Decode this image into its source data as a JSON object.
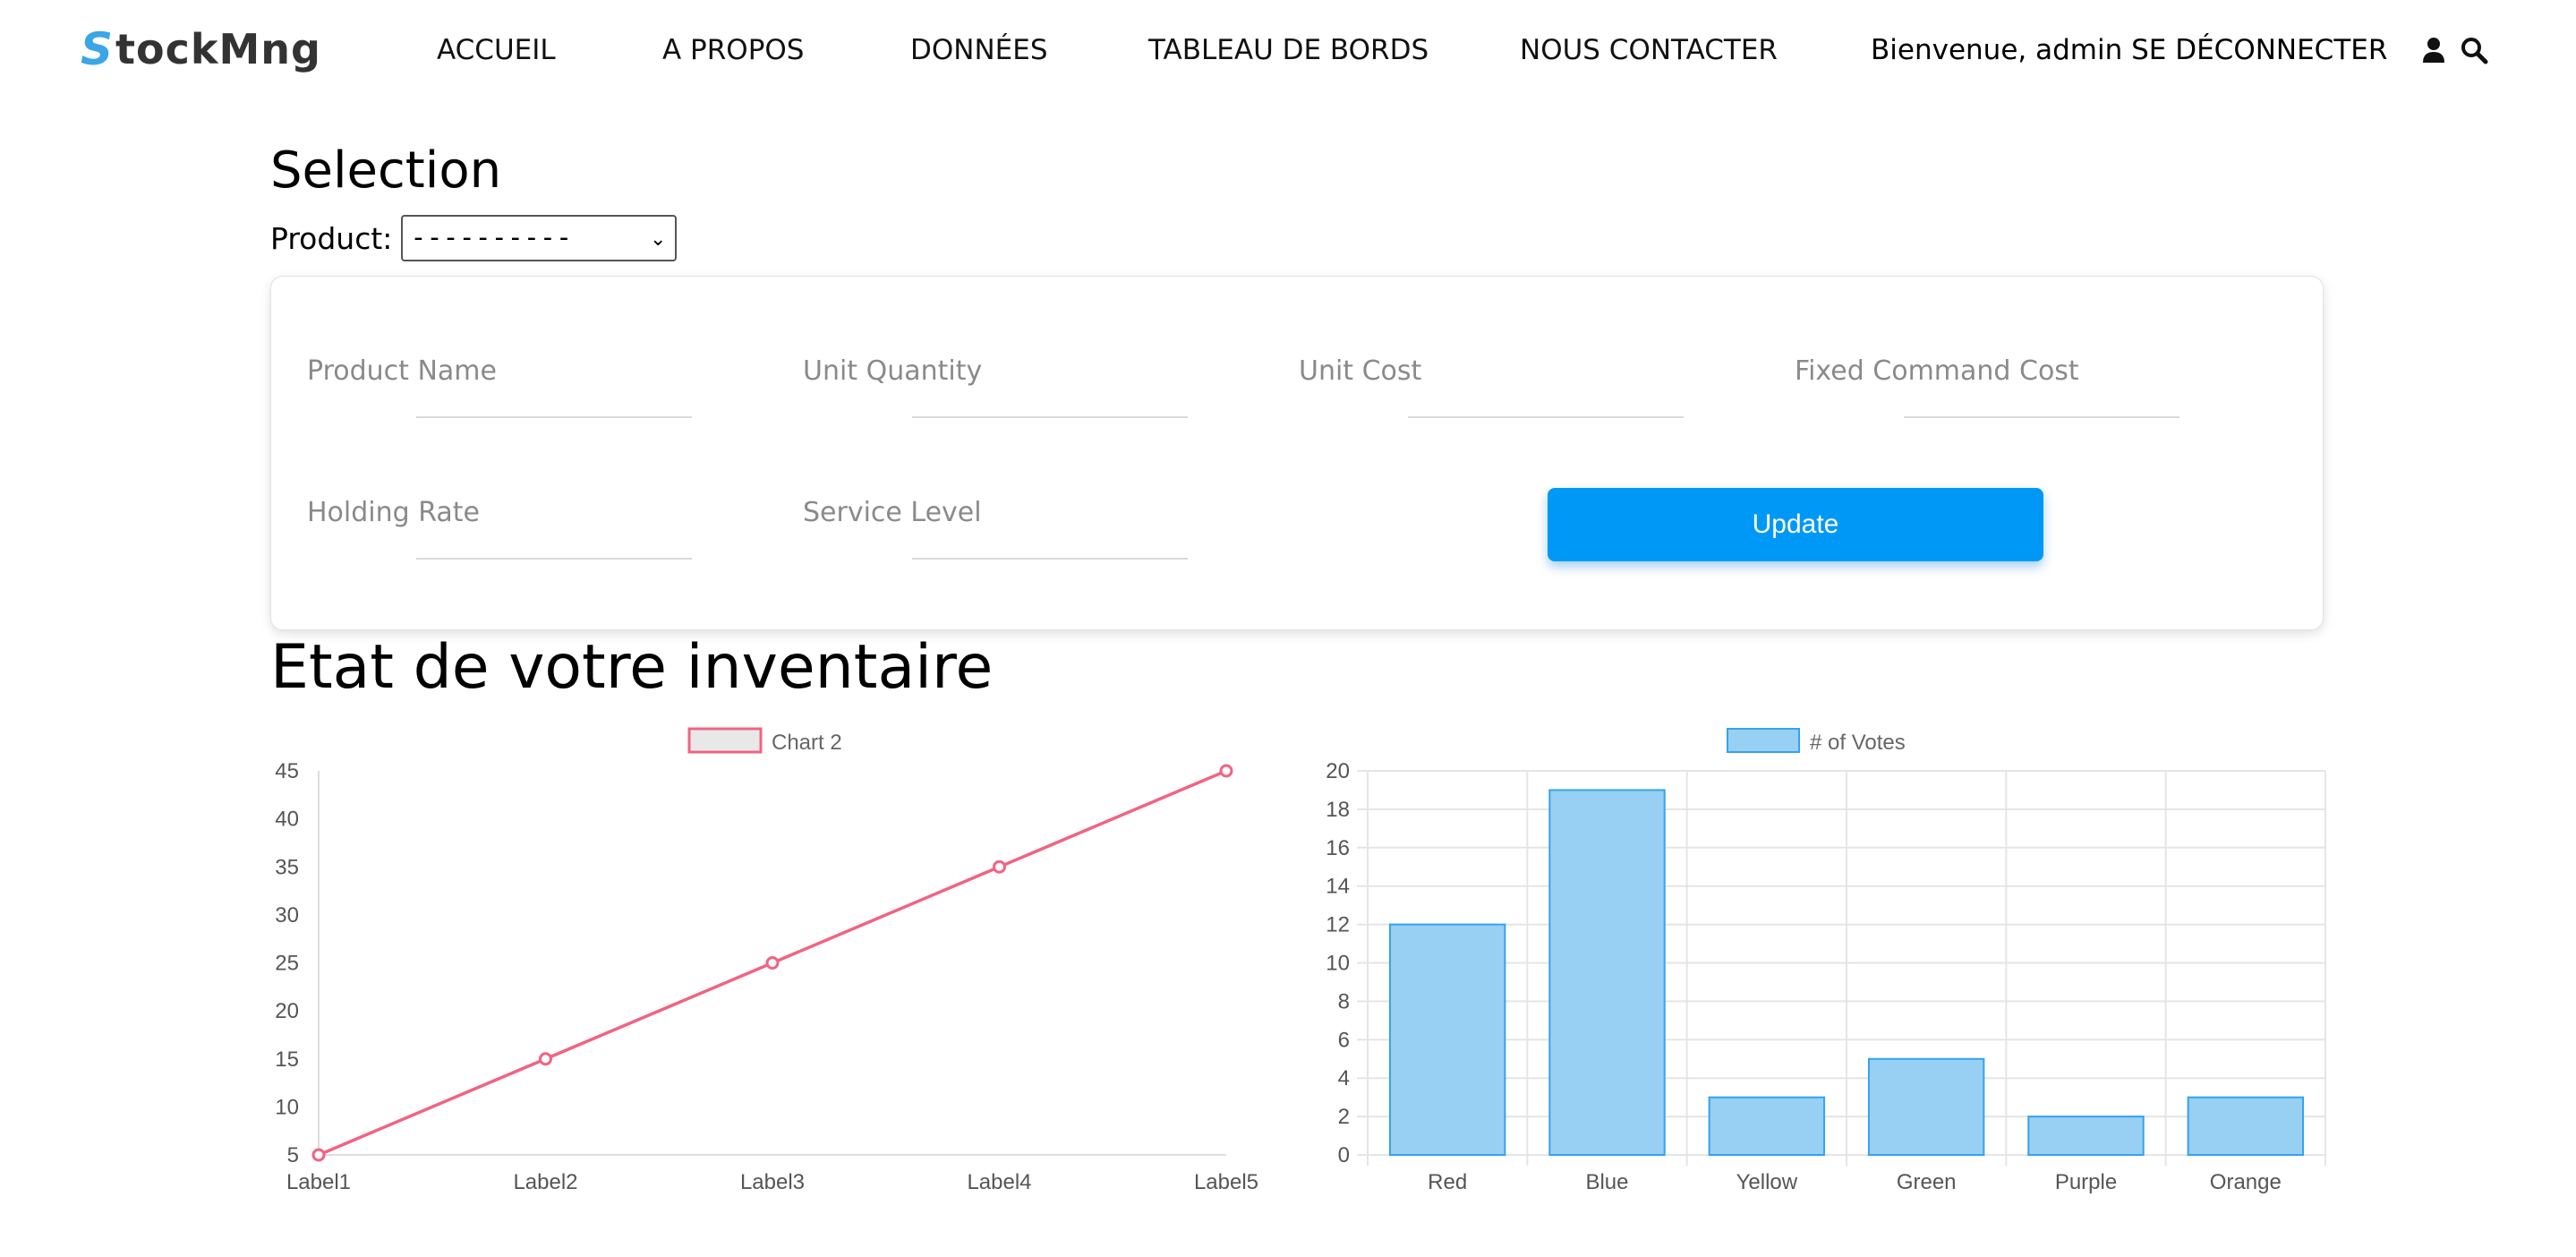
{
  "navbar": {
    "logo_s": "S",
    "logo_rest": "tockMng",
    "items": [
      "ACCUEIL",
      "A PROPOS",
      "DONNÉES",
      "TABLEAU DE BORDS",
      "NOUS CONTACTER"
    ],
    "welcome": "Bienvenue, admin",
    "logout": "SE DÉCONNECTER",
    "icons": [
      "user-icon",
      "search-icon"
    ]
  },
  "selection": {
    "heading": "Selection",
    "product_label": "Product:",
    "product_value": "----------"
  },
  "form": {
    "fields": [
      "Product Name",
      "Unit Quantity",
      "Unit Cost",
      "Fixed Command Cost",
      "Holding Rate",
      "Service Level"
    ],
    "update_label": "Update",
    "accent": "#0098f7"
  },
  "inventory": {
    "heading": "Etat de votre inventaire"
  },
  "chart_data": [
    {
      "type": "line",
      "legend": "Chart 2",
      "categories": [
        "Label1",
        "Label2",
        "Label3",
        "Label4",
        "Label5"
      ],
      "values": [
        5,
        15,
        25,
        35,
        45
      ],
      "yticks": [
        "5",
        "10",
        "15",
        "20",
        "25",
        "30",
        "35",
        "40",
        "45"
      ],
      "ylim": [
        5,
        45
      ],
      "color": "#f16383",
      "grid": false,
      "legend_position": "top"
    },
    {
      "type": "bar",
      "legend": "# of Votes",
      "categories": [
        "Red",
        "Blue",
        "Yellow",
        "Green",
        "Purple",
        "Orange"
      ],
      "values": [
        12,
        19,
        3,
        5,
        2,
        3
      ],
      "yticks": [
        "0",
        "2",
        "4",
        "6",
        "8",
        "10",
        "12",
        "14",
        "16",
        "18",
        "20"
      ],
      "ylim": [
        0,
        20
      ],
      "color": "#36a2eb",
      "fill": "#97d0f3",
      "grid": true,
      "legend_position": "top"
    }
  ]
}
